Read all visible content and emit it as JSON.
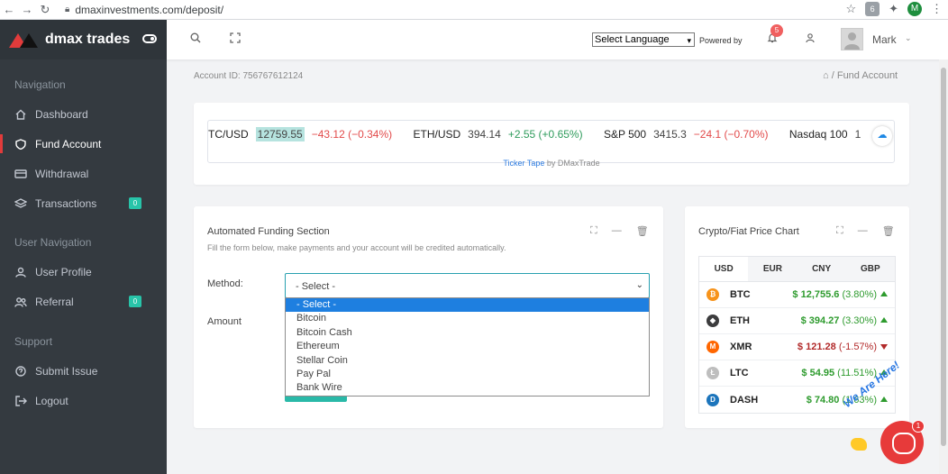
{
  "browser": {
    "url": "dmaxinvestments.com/deposit/",
    "profile_initial": "M",
    "extension_badge": "6"
  },
  "brand": {
    "name": "dmax trades",
    "accent": "#e23b3b"
  },
  "sidebar": {
    "section_navigation": "Navigation",
    "section_user": "User Navigation",
    "section_support": "Support",
    "items": [
      {
        "label": "Dashboard",
        "icon": "home-icon"
      },
      {
        "label": "Fund Account",
        "icon": "shield-icon"
      },
      {
        "label": "Withdrawal",
        "icon": "card-icon"
      },
      {
        "label": "Transactions",
        "icon": "layers-icon",
        "badge": "0"
      },
      {
        "label": "User Profile",
        "icon": "user-icon"
      },
      {
        "label": "Referral",
        "icon": "users-icon",
        "badge": "0"
      },
      {
        "label": "Submit Issue",
        "icon": "help-icon"
      },
      {
        "label": "Logout",
        "icon": "logout-icon"
      }
    ]
  },
  "topbar": {
    "language_select": "Select Language",
    "powered_by": "Powered by",
    "notifications_count": "5",
    "user_name": "Mark"
  },
  "page": {
    "title": "Fund Account",
    "account_id": "Account ID: 756767612124",
    "breadcrumb_current": "Fund Account"
  },
  "ticker": {
    "items": [
      {
        "symbol": "TC/USD",
        "price": "12759.55",
        "change": "−43.12 (−0.34%)",
        "direction": "down"
      },
      {
        "symbol": "ETH/USD",
        "price": "394.14",
        "change": "+2.55 (+0.65%)",
        "direction": "up"
      },
      {
        "symbol": "S&P 500",
        "price": "3415.3",
        "change": "−24.1 (−0.70%)",
        "direction": "down"
      },
      {
        "symbol": "Nasdaq 100",
        "price": "1",
        "change": "",
        "direction": ""
      }
    ],
    "caption_link": "Ticker Tape",
    "caption_rest": "by DMaxTrade"
  },
  "funding": {
    "title": "Automated Funding Section",
    "subtitle": "Fill the form below, make payments and your account will be credited automatically.",
    "method_label": "Method:",
    "amount_label": "Amount",
    "method_value": "- Select -",
    "options": [
      "- Select -",
      "Bitcoin",
      "Bitcoin Cash",
      "Ethereum",
      "Stellar Coin",
      "Pay Pal",
      "Bank Wire"
    ]
  },
  "price_chart": {
    "title": "Crypto/Fiat Price Chart",
    "tabs": [
      "USD",
      "EUR",
      "CNY",
      "GBP"
    ],
    "rows": [
      {
        "ticker": "BTC",
        "value": "$ 12,755.6",
        "change": "(3.80%)",
        "direction": "up",
        "coin_color": "#f7931a",
        "coin_glyph": "₿"
      },
      {
        "ticker": "ETH",
        "value": "$ 394.27",
        "change": "(3.30%)",
        "direction": "up",
        "coin_color": "#3c3c3d",
        "coin_glyph": "◆"
      },
      {
        "ticker": "XMR",
        "value": "$ 121.28",
        "change": "(-1.57%)",
        "direction": "down",
        "coin_color": "#ff6600",
        "coin_glyph": "M"
      },
      {
        "ticker": "LTC",
        "value": "$ 54.95",
        "change": "(11.51%)",
        "direction": "up",
        "coin_color": "#bebebe",
        "coin_glyph": "Ł"
      },
      {
        "ticker": "DASH",
        "value": "$ 74.80",
        "change": "(1.63%)",
        "direction": "up",
        "coin_color": "#1c75bc",
        "coin_glyph": "D"
      }
    ]
  },
  "chat": {
    "text": "We Are Here!",
    "count": "1"
  }
}
